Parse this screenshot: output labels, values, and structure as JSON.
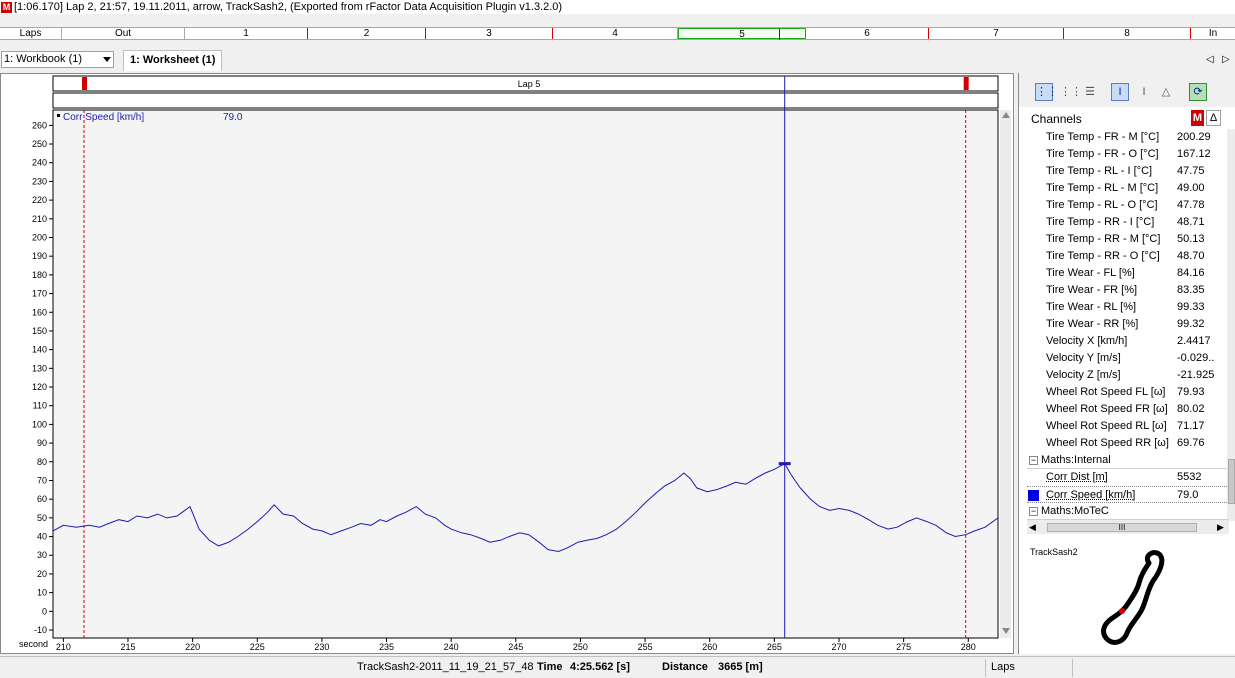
{
  "window": {
    "app_icon": "M",
    "title": "[1:06.170] Lap 2, 21:57, 19.11.2011, arrow, TrackSash2, (Exported from rFactor Data Acquisition Plugin v1.3.2.0)"
  },
  "laps_bar": {
    "items": [
      "Laps",
      "Out",
      "1",
      "2",
      "3",
      "4",
      "5",
      "6",
      "7",
      "8",
      "In"
    ],
    "active": "5"
  },
  "toolbar": {
    "workbook": "1: Workbook (1)",
    "worksheet_tab": "1: Worksheet (1)",
    "nav_left": "◁",
    "nav_right": "▷"
  },
  "graph": {
    "lap_label": "Lap 5",
    "channel_label": "Corr Speed [km/h]",
    "channel_value": "79.0",
    "x_axis_label": "second",
    "line_color": "#1c1cb0",
    "cursor_color": "#1c1cb0",
    "marker_color": "#d40000"
  },
  "chart_data": {
    "type": "line",
    "xlabel": "second",
    "ylabel": "",
    "xlim": [
      209.2,
      282.3
    ],
    "ylim": [
      -10,
      265
    ],
    "x_ticks": [
      210,
      215,
      220,
      225,
      230,
      235,
      240,
      245,
      250,
      255,
      260,
      265,
      270,
      275,
      280
    ],
    "y_ticks": [
      -10,
      0,
      10,
      20,
      30,
      40,
      50,
      60,
      70,
      80,
      90,
      100,
      110,
      120,
      130,
      140,
      150,
      160,
      170,
      180,
      190,
      200,
      210,
      220,
      230,
      240,
      250,
      260
    ],
    "lap_markers_x": [
      211.6,
      279.8
    ],
    "cursor_x": 265.8,
    "series": [
      {
        "name": "Corr Speed [km/h]",
        "x": [
          209.2,
          210.0,
          211.0,
          212.0,
          212.8,
          213.5,
          214.3,
          215.0,
          215.7,
          216.5,
          217.3,
          218.0,
          218.8,
          219.2,
          219.8,
          220.5,
          221.3,
          222.0,
          222.8,
          223.5,
          224.3,
          225.0,
          225.8,
          226.3,
          227.0,
          227.8,
          228.5,
          229.3,
          230.0,
          230.7,
          231.5,
          232.3,
          233.0,
          233.8,
          234.5,
          235.0,
          235.8,
          236.5,
          237.3,
          238.0,
          238.8,
          239.5,
          240.0,
          240.8,
          241.5,
          242.3,
          243.0,
          243.8,
          244.5,
          245.3,
          246.0,
          246.8,
          247.5,
          248.3,
          249.0,
          249.8,
          250.5,
          251.3,
          252.0,
          252.8,
          253.5,
          254.3,
          255.0,
          255.8,
          256.5,
          257.3,
          258.0,
          258.5,
          259.0,
          259.8,
          260.5,
          261.3,
          262.0,
          262.8,
          263.5,
          264.3,
          265.0,
          265.8,
          266.3,
          267.0,
          267.8,
          268.5,
          269.3,
          270.0,
          270.8,
          271.5,
          272.3,
          273.0,
          273.8,
          274.5,
          275.3,
          276.0,
          276.8,
          277.5,
          278.3,
          279.0,
          279.8,
          280.5,
          281.3,
          282.3
        ],
        "values": [
          43,
          46,
          45,
          46,
          45,
          47,
          49,
          48,
          51,
          50,
          52,
          50,
          51,
          53,
          56,
          44,
          38,
          35,
          37,
          40,
          44,
          48,
          53,
          57,
          52,
          51,
          47,
          44,
          43,
          41,
          43,
          45,
          47,
          46,
          49,
          48,
          51,
          53,
          56,
          52,
          50,
          46,
          44,
          42,
          41,
          39,
          37,
          38,
          40,
          42,
          41,
          37,
          33,
          32,
          34,
          37,
          38,
          39,
          41,
          44,
          48,
          53,
          58,
          63,
          67,
          70,
          74,
          71,
          66,
          64,
          65,
          67,
          69,
          68,
          71,
          74,
          76,
          79,
          73,
          66,
          60,
          56,
          54,
          55,
          54,
          52,
          49,
          46,
          44,
          45,
          48,
          50,
          48,
          46,
          42,
          40,
          41,
          43,
          45,
          50
        ]
      }
    ]
  },
  "right_panel": {
    "header": "Channels",
    "m_button": "M",
    "delta_button": "Δ",
    "channels": [
      {
        "name": "Tire Temp - FR - M [°C]",
        "value": "200.29"
      },
      {
        "name": "Tire Temp - FR - O [°C]",
        "value": "167.12"
      },
      {
        "name": "Tire Temp - RL - I [°C]",
        "value": "47.75"
      },
      {
        "name": "Tire Temp - RL - M [°C]",
        "value": "49.00"
      },
      {
        "name": "Tire Temp - RL - O [°C]",
        "value": "47.78"
      },
      {
        "name": "Tire Temp - RR - I [°C]",
        "value": "48.71"
      },
      {
        "name": "Tire Temp - RR - M [°C]",
        "value": "50.13"
      },
      {
        "name": "Tire Temp - RR - O [°C]",
        "value": "48.70"
      },
      {
        "name": "Tire Wear - FL [%]",
        "value": "84.16"
      },
      {
        "name": "Tire Wear - FR [%]",
        "value": "83.35"
      },
      {
        "name": "Tire Wear - RL [%]",
        "value": "99.33"
      },
      {
        "name": "Tire Wear - RR [%]",
        "value": "99.32"
      },
      {
        "name": "Velocity X [km/h]",
        "value": "2.4417"
      },
      {
        "name": "Velocity Y [m/s]",
        "value": "-0.029.."
      },
      {
        "name": "Velocity Z [m/s]",
        "value": "-21.925"
      },
      {
        "name": "Wheel Rot Speed FL [ω]",
        "value": "79.93"
      },
      {
        "name": "Wheel Rot Speed FR [ω]",
        "value": "80.02"
      },
      {
        "name": "Wheel Rot Speed RL [ω]",
        "value": "71.17"
      },
      {
        "name": "Wheel Rot Speed RR [ω]",
        "value": "69.76"
      }
    ],
    "group_internal": "Maths:Internal",
    "internal_channels": [
      {
        "name": "Corr Dist [m]",
        "value": "5532"
      },
      {
        "name": "Corr Speed [km/h]",
        "value": "79.0"
      }
    ],
    "group_motec": "Maths:MoTeC",
    "track_name": "TrackSash2",
    "scroll_grip": "III"
  },
  "status": {
    "file": "TrackSash2-2011_11_19_21_57_48",
    "time_label": "Time",
    "time_value": "4:25.562 [s]",
    "distance_label": "Distance",
    "distance_value": "3665 [m]",
    "laps": "Laps"
  }
}
